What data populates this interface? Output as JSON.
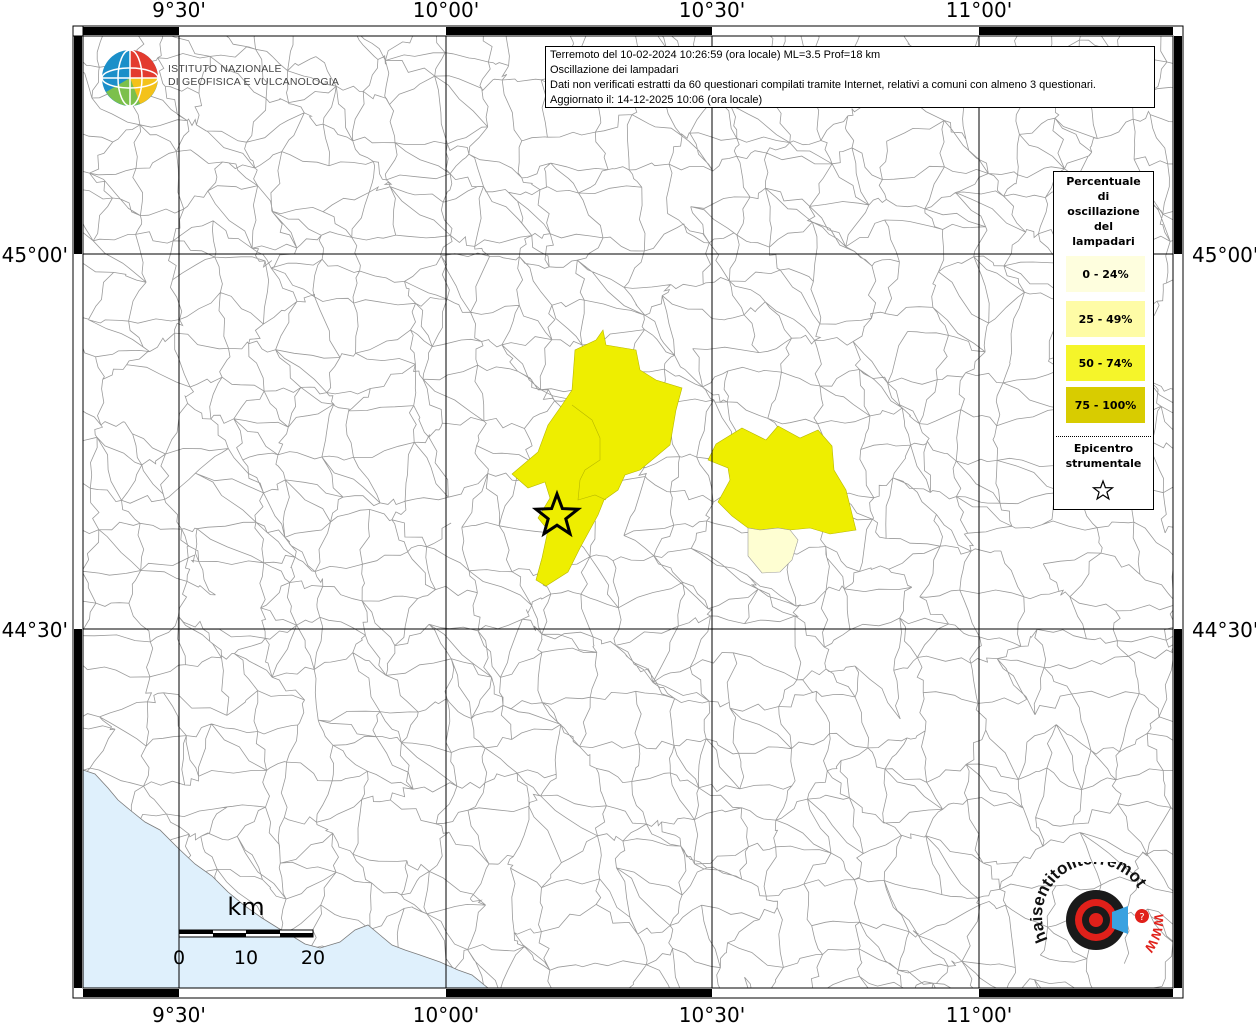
{
  "header": {
    "lines": [
      "Terremoto del 10-02-2024 10:26:59 (ora locale) ML=3.5 Prof=18 km",
      "Oscillazione dei lampadari",
      "Dati non verificati estratti da 60 questionari compilati tramite Internet, relativi a comuni con almeno 3 questionari.",
      "Aggiornato il: 14-12-2025 10:06 (ora locale)"
    ]
  },
  "axes": {
    "lon_ticks": [
      "9°30'",
      "10°00'",
      "10°30'",
      "11°00'"
    ],
    "lat_ticks": [
      "45°00'",
      "44°30'"
    ]
  },
  "legend": {
    "title_lines": [
      "Percentuale",
      "di",
      "oscillazione",
      "del",
      "lampadari"
    ],
    "classes": [
      {
        "label": "0 - 24%",
        "color": "#fefede"
      },
      {
        "label": "25 - 49%",
        "color": "#fefca6"
      },
      {
        "label": "50 - 74%",
        "color": "#f5f52a"
      },
      {
        "label": "75 - 100%",
        "color": "#d8cc00"
      }
    ],
    "epicenter_lines": [
      "Epicentro",
      "strumentale"
    ],
    "epicenter_icon": "star-icon"
  },
  "scalebar": {
    "unit": "km",
    "labels": [
      "0",
      "10",
      "20"
    ]
  },
  "logos": {
    "ingv_lines": [
      "ISTITUTO NAZIONALE",
      "DI GEOFISICA E VULCANOLOGIA"
    ],
    "hst_text": "haisentitoilterremoto.it",
    "hst_url": "WWW"
  },
  "colors": {
    "sea": "#dff0fc",
    "boundary": "#9a9a9a",
    "grid": "#000000",
    "fill_medium": "#eeee00",
    "fill_low": "#fefed2"
  }
}
